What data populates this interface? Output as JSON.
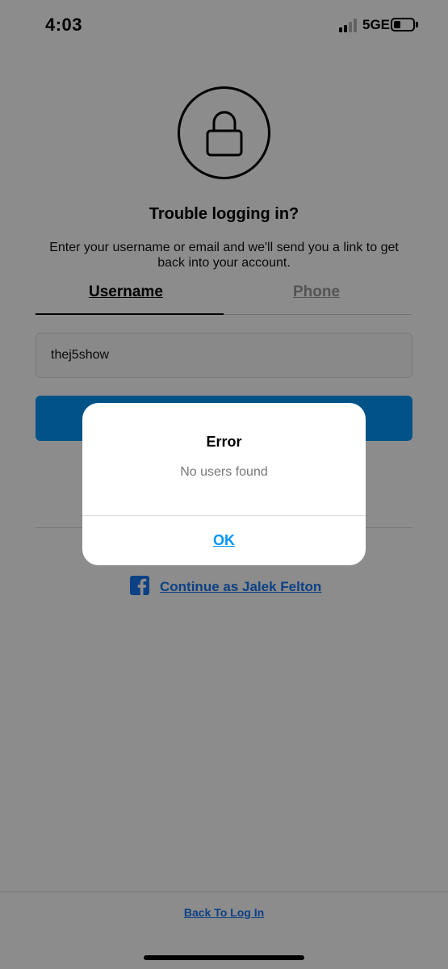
{
  "status_bar": {
    "time": "4:03",
    "network": "5GE",
    "battery_level": 0.35
  },
  "page": {
    "lock_icon": "lock-icon",
    "title": "Trouble logging in?",
    "description": "Enter your username or email and we'll send you a link to get back into your account.",
    "tabs": [
      {
        "label": "Username",
        "active": true
      },
      {
        "label": "Phone",
        "active": false
      }
    ],
    "username_input": {
      "value": "thej5show",
      "placeholder": ""
    },
    "facebook": {
      "icon": "facebook-icon",
      "label": "Continue as Jalek Felton"
    },
    "back_link": "Back To Log In"
  },
  "dialog": {
    "title": "Error",
    "message": "No users found",
    "ok_label": "OK"
  },
  "colors": {
    "accent": "#0095f6",
    "facebook": "#1877f2",
    "overlay": "rgba(0,0,0,0.45)"
  }
}
